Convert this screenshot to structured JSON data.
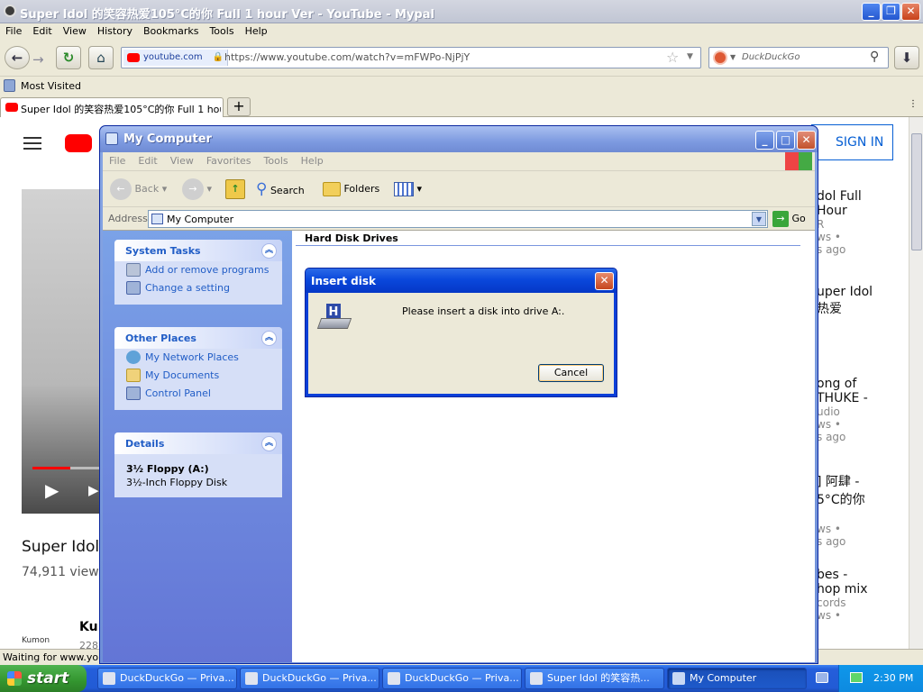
{
  "browser": {
    "title": "Super Idol 的笑容热爱105°C的你 Full 1 hour Ver - YouTube - Mypal",
    "menu": [
      "File",
      "Edit",
      "View",
      "History",
      "Bookmarks",
      "Tools",
      "Help"
    ],
    "site_label": "youtube.com",
    "url": "https://www.youtube.com/watch?v=mFWPo-NjPjY",
    "search_placeholder": "DuckDuckGo",
    "bookmark": "Most Visited",
    "tab_title": "Super Idol 的笑容热爱105°C的你 Full 1 hour...",
    "status": "Waiting for www.youtube.com..."
  },
  "youtube": {
    "sign_in": "SIGN IN",
    "video_title": "Super Idol 的",
    "views": "74,911 views",
    "channel": "Kumon",
    "channel_short": "Ku",
    "channel_subs": "228",
    "sidebar": [
      {
        "line1": "dol Full",
        "line2": "Hour",
        "line3": "R",
        "line4": "ws •",
        "line5": "s ago"
      },
      {
        "line1": "uper Idol",
        "line2": "热爱",
        "line3": "",
        "line4": "",
        "line5": ""
      },
      {
        "line1": "ong of",
        "line2": "THUKE -",
        "line3": "udio",
        "line4": "ws •",
        "line5": "s ago"
      },
      {
        "line1": "] 阿肆 -",
        "line2": "5°C的你",
        "line3": "",
        "line4": "ws •",
        "line5": "s ago"
      },
      {
        "line1": "bes -",
        "line2": "hop mix",
        "line3": "cords",
        "line4": "ws •",
        "line5": ""
      }
    ]
  },
  "explorer": {
    "title": "My Computer",
    "menu": [
      "File",
      "Edit",
      "View",
      "Favorites",
      "Tools",
      "Help"
    ],
    "toolbar": {
      "back": "Back",
      "search": "Search",
      "folders": "Folders"
    },
    "address_label": "Address",
    "address_value": "My Computer",
    "go": "Go",
    "system_tasks": {
      "title": "System Tasks",
      "items": [
        "Add or remove programs",
        "Change a setting"
      ]
    },
    "other_places": {
      "title": "Other Places",
      "items": [
        "My Network Places",
        "My Documents",
        "Control Panel"
      ]
    },
    "details": {
      "title": "Details",
      "name": "3½ Floppy (A:)",
      "desc": "3½-Inch Floppy Disk"
    },
    "section_header": "Hard Disk Drives"
  },
  "dialog": {
    "title": "Insert disk",
    "message": "Please insert a disk into drive A:.",
    "cancel": "Cancel"
  },
  "taskbar": {
    "start": "start",
    "tasks": [
      "DuckDuckGo — Priva...",
      "DuckDuckGo — Priva...",
      "DuckDuckGo — Priva...",
      "Super Idol 的笑容热...",
      "My Computer"
    ],
    "clock": "2:30 PM"
  },
  "colors": {
    "xp_blue": "#0a48dc",
    "youtube_red": "#ff0000",
    "start_green": "#33952f"
  }
}
